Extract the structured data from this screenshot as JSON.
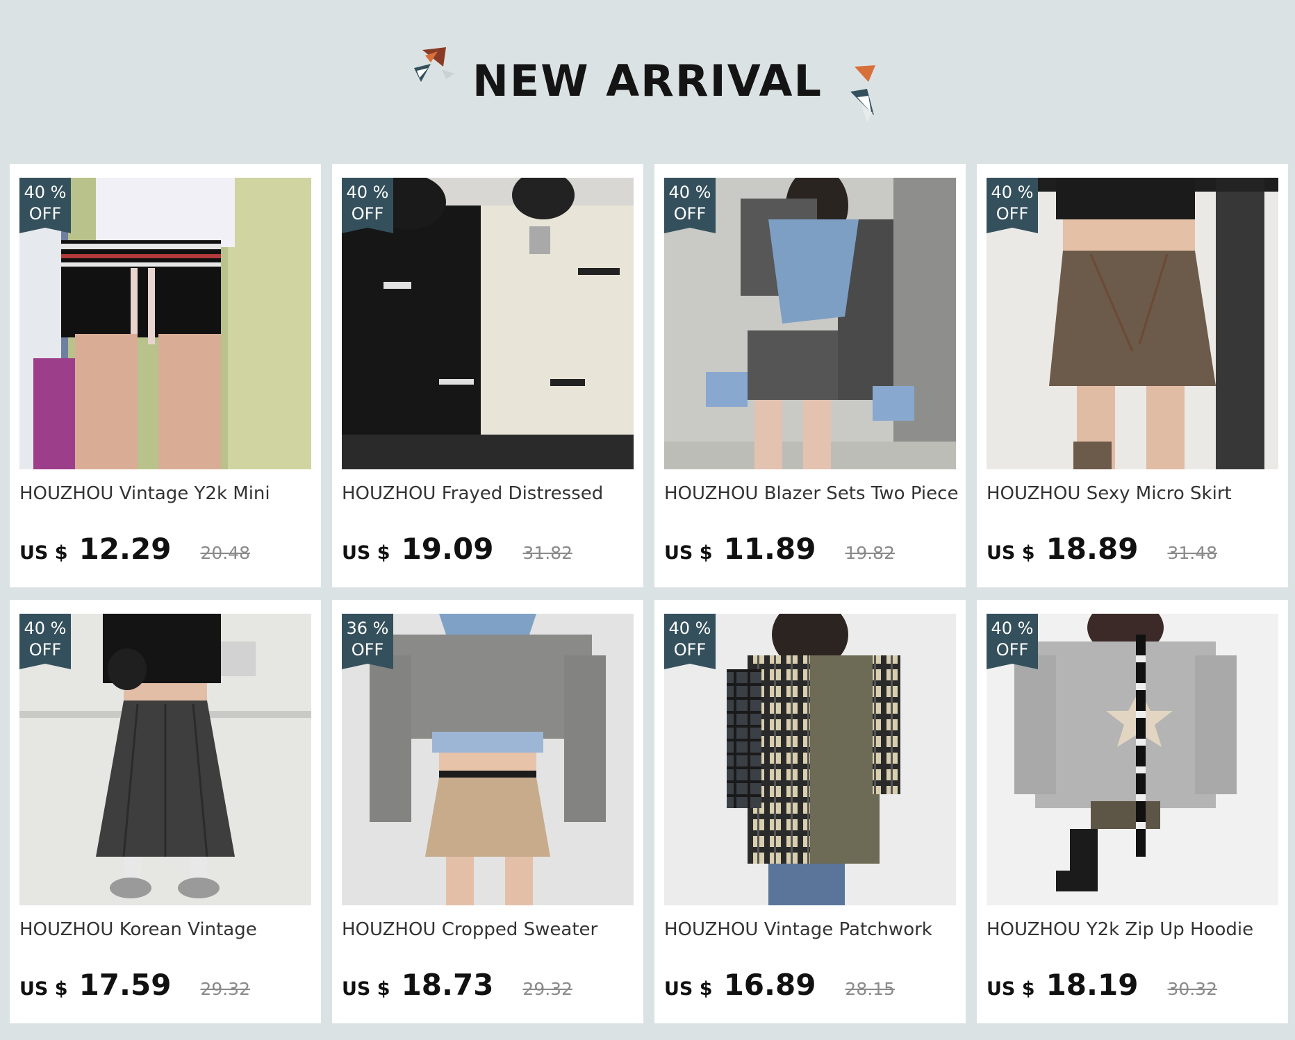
{
  "header": {
    "title": "NEW ARRIVAL"
  },
  "colors": {
    "background": "#dbe2e4",
    "badge": "#34505c",
    "accent_orange": "#d8703a",
    "accent_brown": "#8a3b26"
  },
  "products": [
    {
      "discount": "40 %",
      "off": "OFF",
      "title": "HOUZHOU Vintage Y2k Mini",
      "currency": "US $",
      "price": "12.29",
      "old_price": "20.48",
      "image": "woman-in-white-top-black-mini-skirt"
    },
    {
      "discount": "40 %",
      "off": "OFF",
      "title": "HOUZHOU Frayed Distressed",
      "currency": "US $",
      "price": "19.09",
      "old_price": "31.82",
      "image": "two-women-in-black-and-white-knit-sweaters"
    },
    {
      "discount": "40 %",
      "off": "OFF",
      "title": "HOUZHOU Blazer Sets Two Piece",
      "currency": "US $",
      "price": "11.89",
      "old_price": "19.82",
      "image": "woman-in-gray-blazer-and-mini-skirt"
    },
    {
      "discount": "40 %",
      "off": "OFF",
      "title": "HOUZHOU Sexy Micro Skirt",
      "currency": "US $",
      "price": "18.89",
      "old_price": "31.48",
      "image": "woman-in-brown-pleated-micro-skirt"
    },
    {
      "discount": "40 %",
      "off": "OFF",
      "title": "HOUZHOU Korean Vintage",
      "currency": "US $",
      "price": "17.59",
      "old_price": "29.32",
      "image": "woman-in-long-gray-pleated-skirt"
    },
    {
      "discount": "36 %",
      "off": "OFF",
      "title": "HOUZHOU Cropped Sweater",
      "currency": "US $",
      "price": "18.73",
      "old_price": "29.32",
      "image": "woman-in-gray-cropped-sweater-beige-skirt"
    },
    {
      "discount": "40 %",
      "off": "OFF",
      "title": "HOUZHOU Vintage Patchwork",
      "currency": "US $",
      "price": "16.89",
      "old_price": "28.15",
      "image": "person-in-plaid-patchwork-shirt"
    },
    {
      "discount": "40 %",
      "off": "OFF",
      "title": "HOUZHOU Y2k Zip Up Hoodie",
      "currency": "US $",
      "price": "18.19",
      "old_price": "30.32",
      "image": "woman-in-gray-star-zip-hoodie"
    }
  ]
}
